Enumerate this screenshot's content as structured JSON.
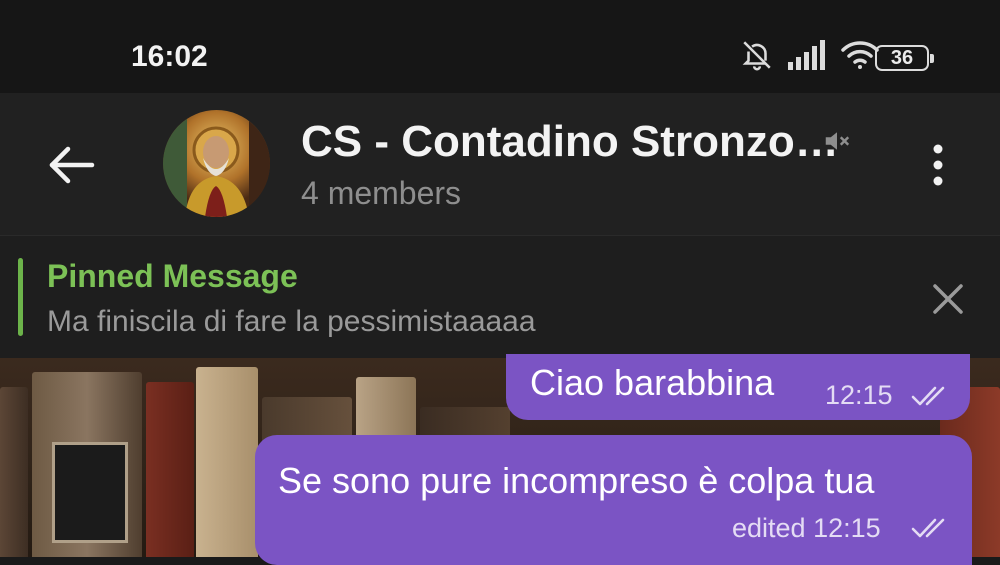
{
  "status_bar": {
    "time": "16:02",
    "battery": "36",
    "icons": [
      "bell-off-icon",
      "signal-icon",
      "wifi-icon",
      "battery-icon"
    ]
  },
  "header": {
    "title": "CS - Contadino Stronzo…",
    "subtitle": "4 members",
    "icons": [
      "back-arrow-icon",
      "muted-icon",
      "more-vertical-icon"
    ]
  },
  "pinned": {
    "title": "Pinned Message",
    "text": "Ma finiscila di fare la pessimistaaaaa"
  },
  "messages": [
    {
      "text": "Ciao barabbina",
      "time": "12:15",
      "status": "read"
    },
    {
      "text": "Se sono pure incompreso è colpa tua",
      "meta": "edited 12:15",
      "status": "read"
    }
  ],
  "colors": {
    "bubble": "#7b54c4",
    "accent": "#7cc156",
    "header_bg": "#212121"
  }
}
